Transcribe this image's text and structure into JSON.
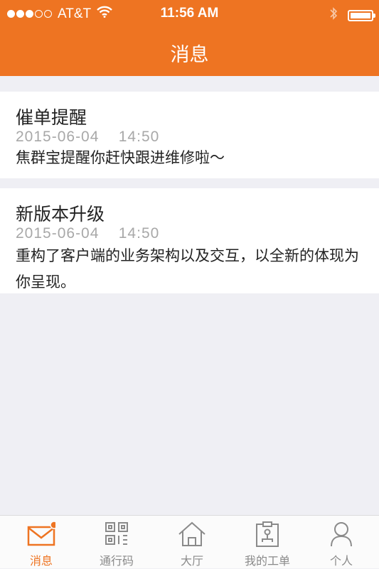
{
  "status_bar": {
    "carrier": "AT&T",
    "time": "11:56 AM",
    "signal_icon": "signal-dots-icon",
    "wifi_icon": "wifi-icon",
    "bluetooth_icon": "bluetooth-icon",
    "battery_icon": "battery-icon"
  },
  "header": {
    "title": "消息"
  },
  "messages": [
    {
      "title": "催单提醒",
      "date": "2015-06-04    14:50",
      "body": "焦群宝提醒你赶快跟进维修啦～"
    },
    {
      "title": "新版本升级",
      "date": "2015-06-04    14:50",
      "body": "重构了客户端的业务架构以及交互，以全新的体现为你呈现。"
    }
  ],
  "tabs": [
    {
      "label": "消息",
      "icon": "mail-icon",
      "active": true,
      "badge": true
    },
    {
      "label": "通行码",
      "icon": "qr-code-icon",
      "active": false
    },
    {
      "label": "大厅",
      "icon": "home-icon",
      "active": false
    },
    {
      "label": "我的工单",
      "icon": "clipboard-icon",
      "active": false
    },
    {
      "label": "个人",
      "icon": "person-icon",
      "active": false
    }
  ],
  "colors": {
    "accent": "#ee7422",
    "background": "#efeff4",
    "inactive": "#8a8a8a"
  }
}
